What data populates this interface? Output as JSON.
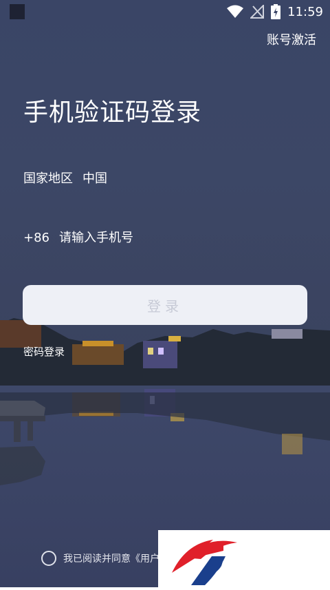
{
  "status_bar": {
    "time": "11:59",
    "icons": [
      "wifi-icon",
      "signal-off-icon",
      "battery-charging-icon"
    ]
  },
  "header": {
    "activate_link": "账号激活"
  },
  "main": {
    "title": "手机验证码登录",
    "region_label": "国家地区",
    "region_value": "中国",
    "phone_prefix": "+86",
    "phone_placeholder": "请输入手机号",
    "login_button": "登录",
    "password_login_link": "密码登录"
  },
  "footer": {
    "agreement_text": "我已阅读并同意《用户"
  },
  "colors": {
    "background": "#3a4566",
    "button_bg": "#eef0f6",
    "button_text": "#c7cad6"
  }
}
